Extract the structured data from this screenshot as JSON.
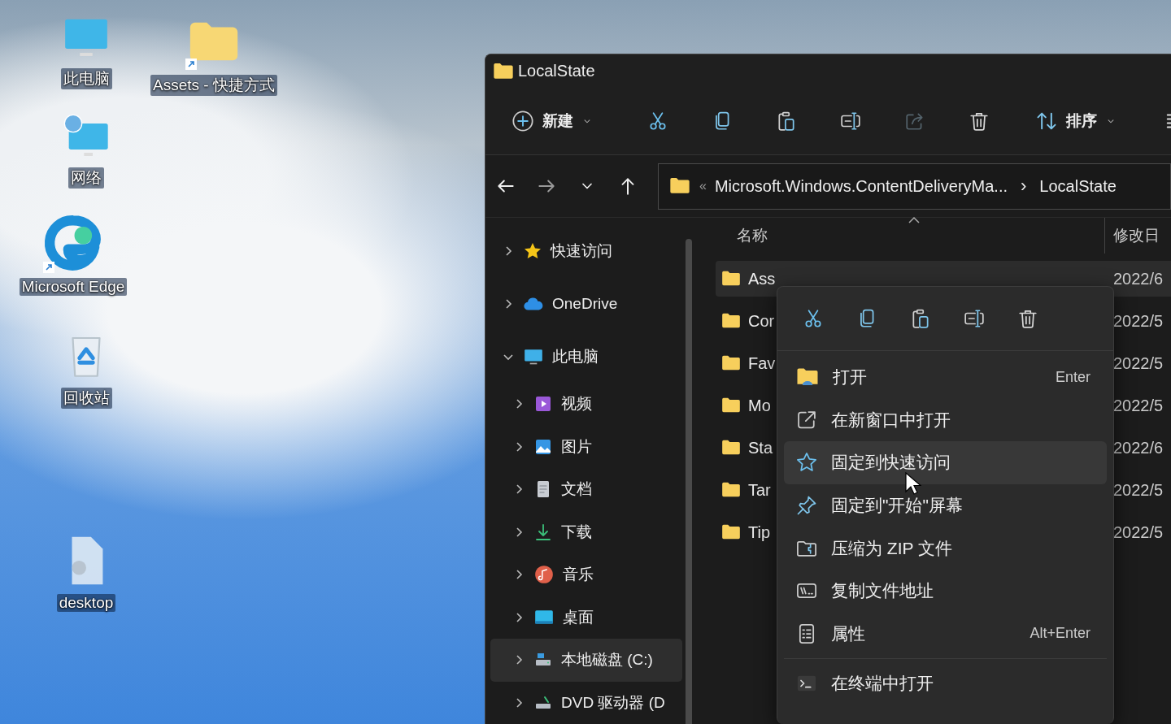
{
  "desktop": {
    "icons": [
      {
        "label": "此电脑",
        "shortcut": false
      },
      {
        "label": "Assets - 快捷方式",
        "shortcut": true
      },
      {
        "label": "网络",
        "shortcut": false
      },
      {
        "label": "Microsoft Edge",
        "shortcut": true
      },
      {
        "label": "回收站",
        "shortcut": false
      },
      {
        "label": "desktop",
        "shortcut": false
      }
    ]
  },
  "window": {
    "title": "LocalState"
  },
  "toolbar": {
    "new_label": "新建",
    "actions": [
      {
        "disabled": false
      },
      {
        "disabled": false
      },
      {
        "disabled": false
      },
      {
        "disabled": false
      },
      {
        "disabled": true
      },
      {
        "disabled": false
      }
    ],
    "sort_label": "排序"
  },
  "address_bar": {
    "overflow": "«",
    "separator": "›",
    "segments": [
      "Microsoft.Windows.ContentDeliveryMa...",
      "LocalState"
    ]
  },
  "sidebar": {
    "items": [
      {
        "label": "快速访问",
        "expanded": false,
        "selected": false
      },
      {
        "label": "OneDrive",
        "expanded": false,
        "selected": false
      },
      {
        "label": "此电脑",
        "expanded": true,
        "selected": false,
        "children": [
          {
            "label": "视频",
            "expanded": false,
            "selected": false
          },
          {
            "label": "图片",
            "expanded": false,
            "selected": false
          },
          {
            "label": "文档",
            "expanded": false,
            "selected": false
          },
          {
            "label": "下载",
            "expanded": false,
            "selected": false
          },
          {
            "label": "音乐",
            "expanded": false,
            "selected": false
          },
          {
            "label": "桌面",
            "expanded": false,
            "selected": false
          },
          {
            "label": "本地磁盘 (C:)",
            "expanded": false,
            "selected": true
          },
          {
            "label": "DVD 驱动器 (D",
            "expanded": false,
            "selected": false
          }
        ]
      }
    ]
  },
  "file_list": {
    "columns": [
      "名称",
      "修改日"
    ],
    "rows": [
      {
        "name": "Ass",
        "date": "2022/6",
        "selected": true
      },
      {
        "name": "Cor",
        "date": "2022/5",
        "selected": false
      },
      {
        "name": "Fav",
        "date": "2022/5",
        "selected": false
      },
      {
        "name": "Mo",
        "date": "2022/5",
        "selected": false
      },
      {
        "name": "Sta",
        "date": "2022/6",
        "selected": false
      },
      {
        "name": "Tar",
        "date": "2022/5",
        "selected": false
      },
      {
        "name": "Tip",
        "date": "2022/5",
        "selected": false
      }
    ]
  },
  "context_menu": {
    "items": [
      {
        "label": "打开",
        "shortcut": "Enter",
        "selected": false
      },
      {
        "label": "在新窗口中打开",
        "selected": false
      },
      {
        "label": "固定到快速访问",
        "selected": true
      },
      {
        "label": "固定到\"开始\"屏幕",
        "selected": false
      },
      {
        "label": "压缩为 ZIP 文件",
        "selected": false
      },
      {
        "label": "复制文件地址",
        "selected": false
      },
      {
        "label": "属性",
        "shortcut": "Alt+Enter",
        "selected": false
      }
    ],
    "footer_items": [
      {
        "label": "在终端中打开",
        "selected": false
      }
    ]
  }
}
